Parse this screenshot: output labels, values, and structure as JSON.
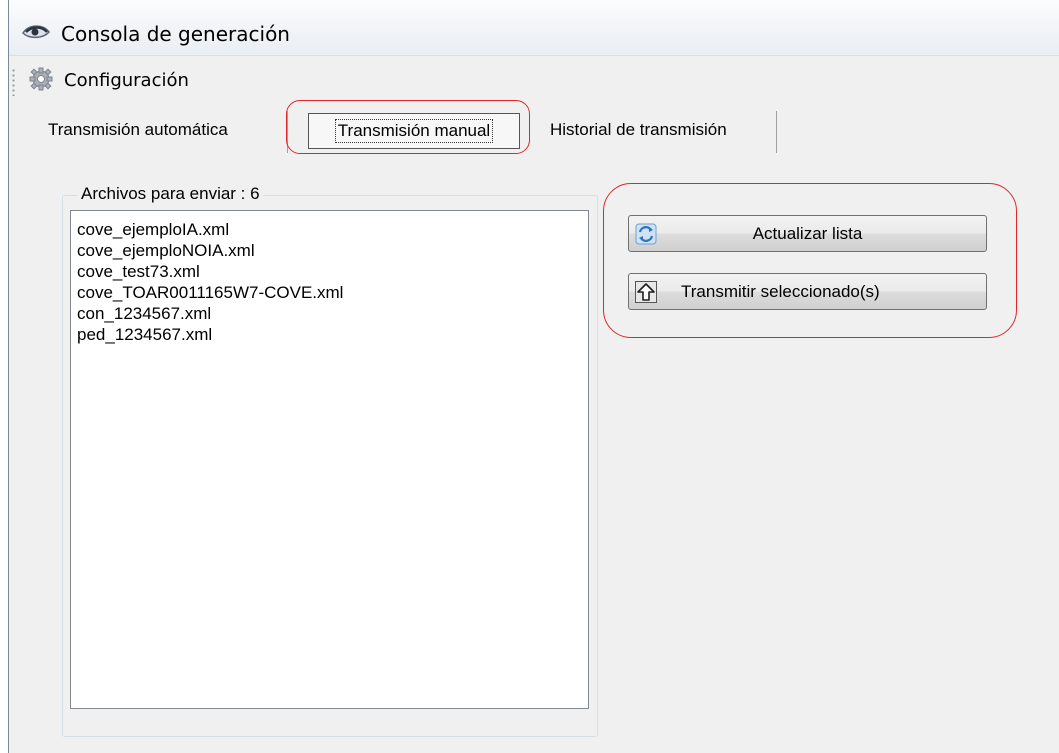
{
  "window": {
    "title": "Consola de generación"
  },
  "toolbar": {
    "config_label": "Configuración"
  },
  "tabs": [
    {
      "label": "Transmisión automática",
      "selected": false
    },
    {
      "label": "Transmisión manual",
      "selected": true
    },
    {
      "label": "Historial de transmisión",
      "selected": false
    }
  ],
  "files_group": {
    "legend": "Archivos para enviar : 6",
    "items": [
      "cove_ejemploIA.xml",
      "cove_ejemploNOIA.xml",
      "cove_test73.xml",
      "cove_TOAR0011165W7-COVE.xml",
      "con_1234567.xml",
      "ped_1234567.xml"
    ]
  },
  "buttons": {
    "refresh_label": "Actualizar lista",
    "transmit_label": "Transmitir seleccionado(s)"
  },
  "colors": {
    "highlight": "#e0262b",
    "window_bg": "#f0f0f0"
  }
}
